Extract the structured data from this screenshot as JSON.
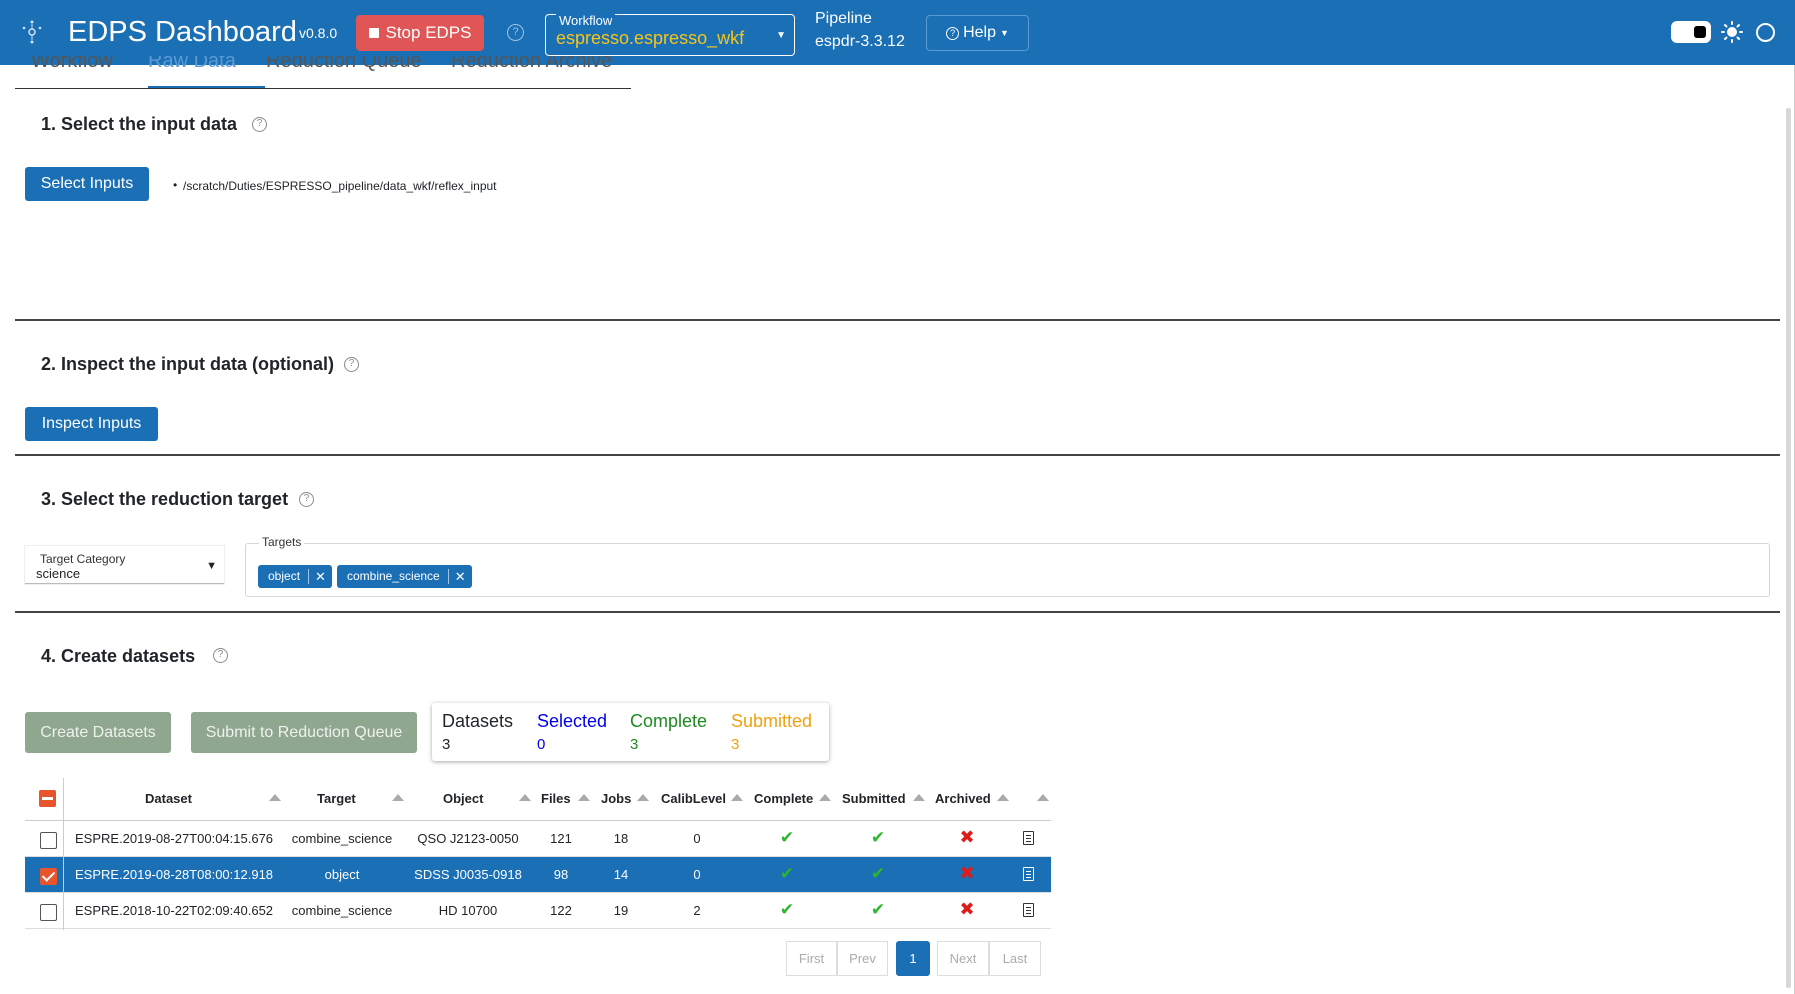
{
  "app": {
    "title": "EDPS Dashboard",
    "version": "v0.8.0",
    "stop_label": "Stop EDPS",
    "workflow_label": "Workflow",
    "workflow_value": "espresso.espresso_wkf",
    "pipeline_label": "Pipeline",
    "pipeline_value": "espdr-3.3.12",
    "help_label": "Help"
  },
  "tabs": [
    {
      "label": "Workflow",
      "active": false
    },
    {
      "label": "Raw Data",
      "active": true
    },
    {
      "label": "Reduction Queue",
      "active": false
    },
    {
      "label": "Reduction Archive",
      "active": false
    }
  ],
  "section1": {
    "title": "1. Select the input data",
    "button": "Select Inputs",
    "paths": [
      "/scratch/Duties/ESPRESSO_pipeline/data_wkf/reflex_input"
    ]
  },
  "section2": {
    "title": "2. Inspect the input data (optional)",
    "button": "Inspect Inputs"
  },
  "section3": {
    "title": "3. Select the reduction target",
    "category_label": "Target Category",
    "category_value": "science",
    "targets_label": "Targets",
    "targets": [
      "object",
      "combine_science"
    ]
  },
  "section4": {
    "title": "4. Create datasets",
    "create_button": "Create Datasets",
    "submit_button": "Submit to Reduction Queue",
    "stats": {
      "datasets_label": "Datasets",
      "datasets_value": "3",
      "selected_label": "Selected",
      "selected_value": "0",
      "complete_label": "Complete",
      "complete_value": "3",
      "submitted_label": "Submitted",
      "submitted_value": "3"
    }
  },
  "table": {
    "columns": [
      "Dataset",
      "Target",
      "Object",
      "Files",
      "Jobs",
      "CalibLevel",
      "Complete",
      "Submitted",
      "Archived"
    ],
    "rows": [
      {
        "dataset": "ESPRE.2019-08-27T00:04:15.676",
        "target": "combine_science",
        "object": "QSO J2123-0050",
        "files": "121",
        "jobs": "18",
        "calib": "0",
        "complete": true,
        "submitted": true,
        "archived": false,
        "checked": false
      },
      {
        "dataset": "ESPRE.2019-08-28T08:00:12.918",
        "target": "object",
        "object": "SDSS J0035-0918",
        "files": "98",
        "jobs": "14",
        "calib": "0",
        "complete": true,
        "submitted": true,
        "archived": false,
        "checked": true
      },
      {
        "dataset": "ESPRE.2018-10-22T02:09:40.652",
        "target": "combine_science",
        "object": "HD 10700",
        "files": "122",
        "jobs": "19",
        "calib": "2",
        "complete": true,
        "submitted": true,
        "archived": false,
        "checked": false
      }
    ]
  },
  "pagination": {
    "first": "First",
    "prev": "Prev",
    "current": "1",
    "next": "Next",
    "last": "Last"
  },
  "colors": {
    "navbar": "#1a6fb5",
    "stop": "#e05555",
    "workflow_value": "#f5c518",
    "selected_stat": "#0000ee",
    "complete_stat": "#1f8a1f",
    "submitted_stat": "#f0a010",
    "check": "#2db52d",
    "cross": "#e01b1b"
  },
  "icons": {
    "check": "✔",
    "cross": "✖",
    "question": "?"
  }
}
